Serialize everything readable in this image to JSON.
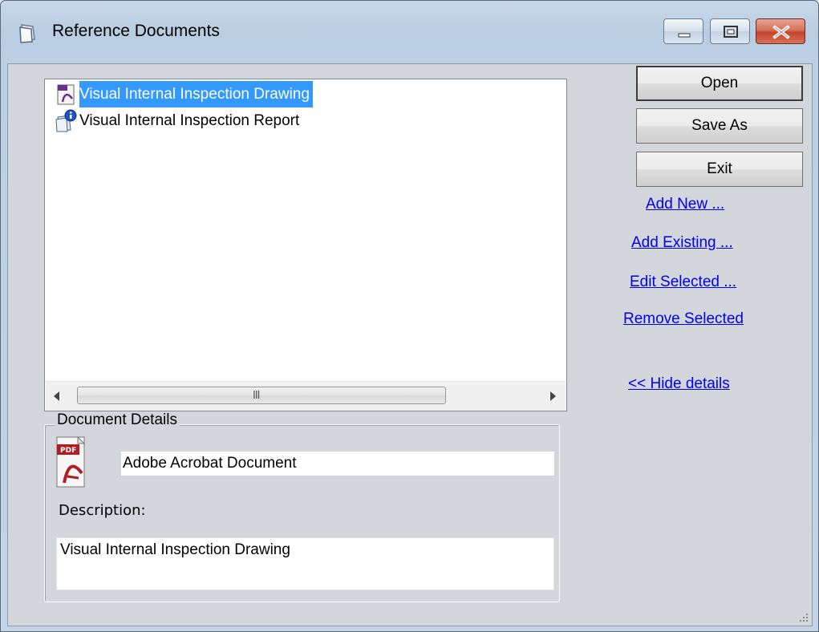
{
  "window": {
    "title": "Reference Documents"
  },
  "documents": [
    {
      "label": "Visual Internal Inspection Drawing",
      "icon": "pdf-document-icon",
      "selected": true
    },
    {
      "label": "Visual Internal Inspection Report",
      "icon": "report-info-icon",
      "selected": false
    }
  ],
  "buttons": {
    "open": "Open",
    "save_as": "Save As",
    "exit": "Exit"
  },
  "links": {
    "add_new": "Add New ...",
    "add_existing": "Add Existing ...",
    "edit_selected": "Edit Selected ...",
    "remove_selected": "Remove Selected",
    "hide_details": "<< Hide details"
  },
  "details": {
    "group_label": "Document Details",
    "type_label": "PDF",
    "document_type": "Adobe Acrobat Document",
    "description_label": "Description:",
    "description": "Visual Internal Inspection Drawing"
  },
  "scrollbar": {
    "grip": "III"
  },
  "colors": {
    "selection": "#3399ff",
    "link": "#0000ee",
    "close_button": "#c4442c"
  }
}
